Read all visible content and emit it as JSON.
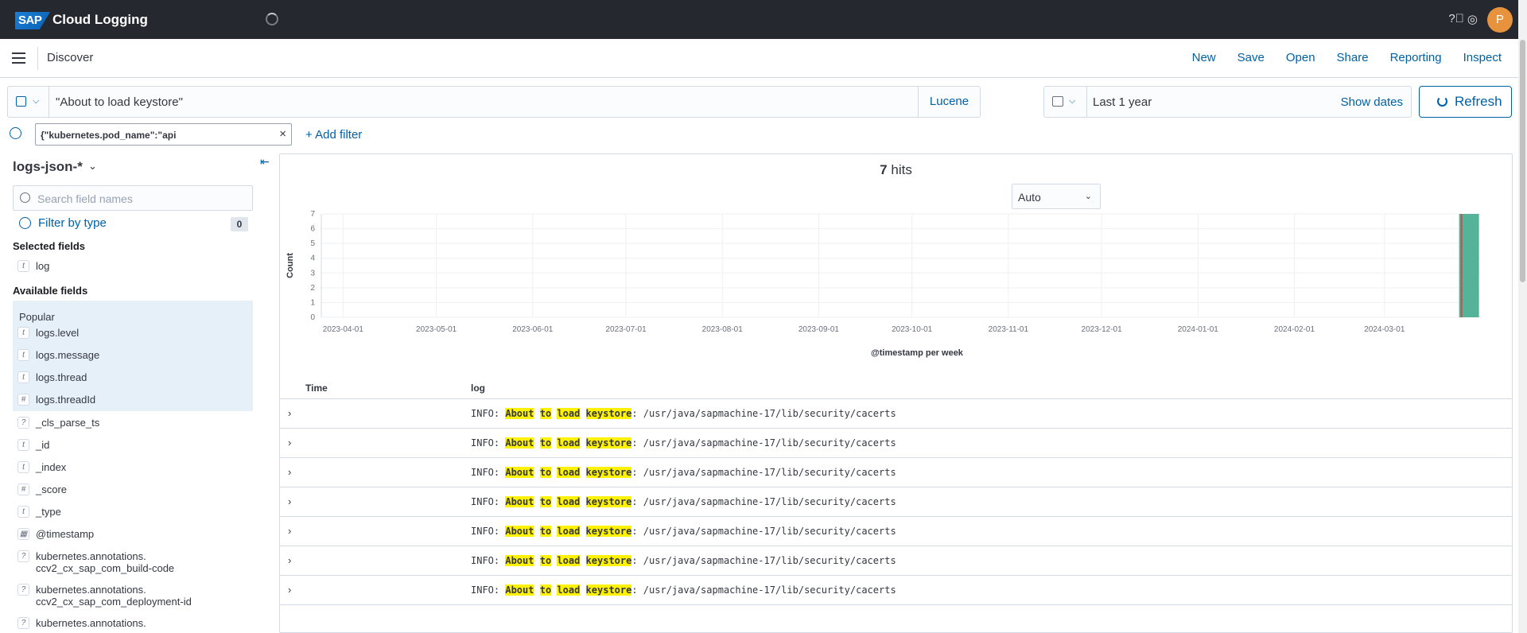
{
  "app": {
    "logo_text": "SAP",
    "title": "Cloud Logging",
    "avatar_initial": "P"
  },
  "nav": {
    "title": "Discover",
    "actions": [
      "New",
      "Save",
      "Open",
      "Share",
      "Reporting",
      "Inspect"
    ]
  },
  "query": {
    "text": "\"About to load keystore\"",
    "language": "Lucene"
  },
  "time": {
    "range_label": "Last 1 year",
    "show_dates_label": "Show dates",
    "refresh_label": "Refresh"
  },
  "filter": {
    "pill_text": "{\"kubernetes.pod_name\":\"api",
    "add_label": "+ Add filter"
  },
  "sidebar": {
    "index_pattern": "logs-json-*",
    "search_placeholder": "Search field names",
    "filter_by_type_label": "Filter by type",
    "filter_count": "0",
    "selected_label": "Selected fields",
    "selected_fields": [
      {
        "type": "t",
        "name": "log"
      }
    ],
    "available_label": "Available fields",
    "popular_label": "Popular",
    "popular_fields": [
      {
        "type": "t",
        "name": "logs.level"
      },
      {
        "type": "t",
        "name": "logs.message"
      },
      {
        "type": "t",
        "name": "logs.thread"
      },
      {
        "type": "#",
        "name": "logs.threadId"
      }
    ],
    "other_fields": [
      {
        "type": "?",
        "name": "_cls_parse_ts"
      },
      {
        "type": "t",
        "name": "_id"
      },
      {
        "type": "t",
        "name": "_index"
      },
      {
        "type": "#",
        "name": "_score"
      },
      {
        "type": "t",
        "name": "_type"
      },
      {
        "type": "cal",
        "name": "@timestamp"
      },
      {
        "type": "?",
        "name": "kubernetes.annotations.",
        "name2": "ccv2_cx_sap_com_build-code"
      },
      {
        "type": "?",
        "name": "kubernetes.annotations.",
        "name2": "ccv2_cx_sap_com_deployment-id"
      },
      {
        "type": "?",
        "name": "kubernetes.annotations.",
        "name2": ""
      }
    ]
  },
  "hits": {
    "count": "7",
    "label": "hits",
    "interval": "Auto"
  },
  "chart_data": {
    "type": "bar",
    "title": "",
    "xlabel": "@timestamp per week",
    "ylabel": "Count",
    "ylim": [
      0,
      7
    ],
    "yticks": [
      "0",
      "1",
      "2",
      "3",
      "4",
      "5",
      "6",
      "7"
    ],
    "xticks": [
      "2023-04-01",
      "2023-05-01",
      "2023-06-01",
      "2023-07-01",
      "2023-08-01",
      "2023-09-01",
      "2023-10-01",
      "2023-11-01",
      "2023-12-01",
      "2024-01-01",
      "2024-02-01",
      "2024-03-01"
    ],
    "x": [
      "2024-03-25"
    ],
    "values": [
      7
    ],
    "bar_color": "#54b399"
  },
  "table": {
    "col_time": "Time",
    "col_log": "log",
    "rows": [
      {
        "prefix": "INFO: ",
        "h1": "About",
        "h2": "to",
        "h3": "load",
        "h4": "keystore",
        "suffix": ": /usr/java/sapmachine-17/lib/security/cacerts"
      },
      {
        "prefix": "INFO: ",
        "h1": "About",
        "h2": "to",
        "h3": "load",
        "h4": "keystore",
        "suffix": ": /usr/java/sapmachine-17/lib/security/cacerts"
      },
      {
        "prefix": "INFO: ",
        "h1": "About",
        "h2": "to",
        "h3": "load",
        "h4": "keystore",
        "suffix": ": /usr/java/sapmachine-17/lib/security/cacerts"
      },
      {
        "prefix": "INFO: ",
        "h1": "About",
        "h2": "to",
        "h3": "load",
        "h4": "keystore",
        "suffix": ": /usr/java/sapmachine-17/lib/security/cacerts"
      },
      {
        "prefix": "INFO: ",
        "h1": "About",
        "h2": "to",
        "h3": "load",
        "h4": "keystore",
        "suffix": ": /usr/java/sapmachine-17/lib/security/cacerts"
      },
      {
        "prefix": "INFO: ",
        "h1": "About",
        "h2": "to",
        "h3": "load",
        "h4": "keystore",
        "suffix": ": /usr/java/sapmachine-17/lib/security/cacerts"
      },
      {
        "prefix": "INFO: ",
        "h1": "About",
        "h2": "to",
        "h3": "load",
        "h4": "keystore",
        "suffix": ": /usr/java/sapmachine-17/lib/security/cacerts"
      }
    ]
  }
}
